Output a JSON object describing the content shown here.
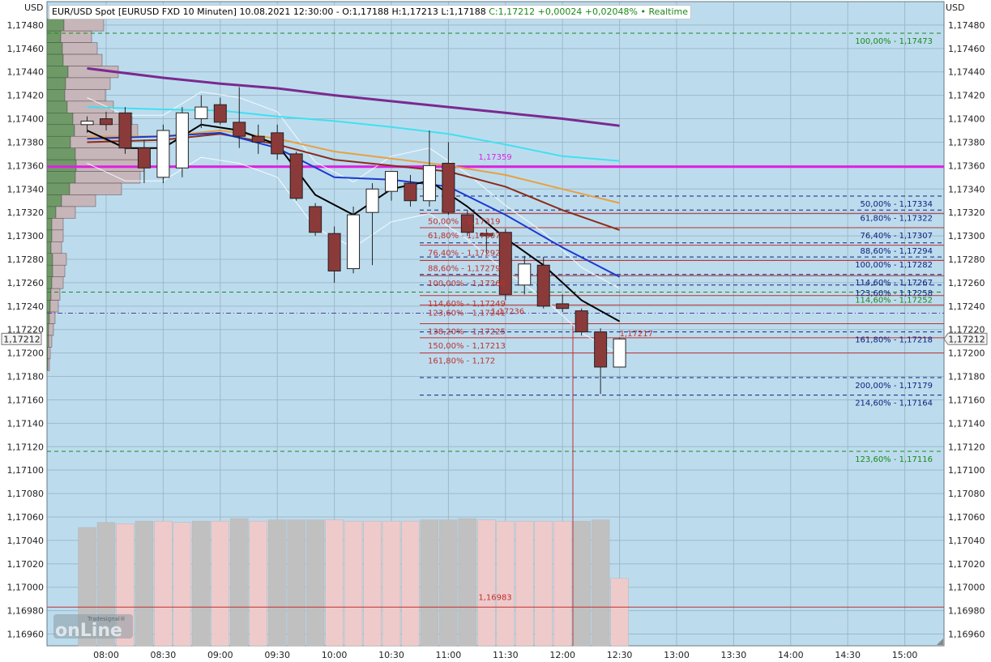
{
  "header": {
    "title": "EUR/USD Spot [EURUSD FXD 10 Minuten] 10.08.2021 12:30:00 - O:1,17188 H:1,17213 L:1,17188",
    "realtime": "C:1,17212 +0,00024 +0,02048% • Realtime"
  },
  "units": {
    "left": "USD",
    "right": "USD"
  },
  "watermark": {
    "small": "Tradesignal®",
    "big": "onLine"
  },
  "colors": {
    "plot_bg": "#bcdcee",
    "grid": "#9fb8c8",
    "bull": "#ffffff",
    "bear": "#8b3a3a",
    "magenta": "#e020e0",
    "purple": "#7a2a90",
    "cyan": "#40e0f0",
    "blue": "#1a3ad0",
    "brown": "#8b2c1a",
    "orange": "#e8a040",
    "black": "#000000",
    "green_dash": "#1a8a1a",
    "navy_dash": "#102080",
    "red_line": "#c03030"
  },
  "chart_data": {
    "type": "candlestick",
    "instrument": "EUR/USD Spot",
    "ylim": [
      1.1695,
      1.175
    ],
    "y_ticks": [
      "1,16960",
      "1,16980",
      "1,17000",
      "1,17020",
      "1,17040",
      "1,17060",
      "1,17080",
      "1,17100",
      "1,17120",
      "1,17140",
      "1,17160",
      "1,17180",
      "1,17200",
      "1,17220",
      "1,17240",
      "1,17260",
      "1,17280",
      "1,17300",
      "1,17320",
      "1,17340",
      "1,17360",
      "1,17380",
      "1,17400",
      "1,17420",
      "1,17440",
      "1,17460",
      "1,17480"
    ],
    "x_ticks": [
      "08:00",
      "08:30",
      "09:00",
      "09:30",
      "10:00",
      "10:30",
      "11:00",
      "11:30",
      "12:00",
      "12:30",
      "13:00",
      "13:30",
      "14:00",
      "14:30",
      "15:00"
    ],
    "last_price_label": "1,17212",
    "last_price": 1.17212,
    "candles": [
      {
        "t": "07:50",
        "o": 1.17395,
        "h": 1.17402,
        "l": 1.17388,
        "c": 1.17398
      },
      {
        "t": "08:00",
        "o": 1.174,
        "h": 1.17406,
        "l": 1.1739,
        "c": 1.17395
      },
      {
        "t": "08:10",
        "o": 1.17405,
        "h": 1.1741,
        "l": 1.1737,
        "c": 1.17375
      },
      {
        "t": "08:20",
        "o": 1.17375,
        "h": 1.17382,
        "l": 1.17345,
        "c": 1.17358
      },
      {
        "t": "08:30",
        "o": 1.1735,
        "h": 1.17395,
        "l": 1.17345,
        "c": 1.1739
      },
      {
        "t": "08:40",
        "o": 1.17358,
        "h": 1.1741,
        "l": 1.1735,
        "c": 1.17405
      },
      {
        "t": "08:50",
        "o": 1.174,
        "h": 1.1742,
        "l": 1.17392,
        "c": 1.1741
      },
      {
        "t": "09:00",
        "o": 1.17412,
        "h": 1.17418,
        "l": 1.17395,
        "c": 1.17397
      },
      {
        "t": "09:10",
        "o": 1.17397,
        "h": 1.17427,
        "l": 1.17375,
        "c": 1.17385
      },
      {
        "t": "09:20",
        "o": 1.17385,
        "h": 1.17395,
        "l": 1.1737,
        "c": 1.1738
      },
      {
        "t": "09:30",
        "o": 1.17388,
        "h": 1.17395,
        "l": 1.17365,
        "c": 1.1737
      },
      {
        "t": "09:40",
        "o": 1.1737,
        "h": 1.17372,
        "l": 1.1733,
        "c": 1.17332
      },
      {
        "t": "09:50",
        "o": 1.17325,
        "h": 1.17328,
        "l": 1.173,
        "c": 1.17303
      },
      {
        "t": "10:00",
        "o": 1.17302,
        "h": 1.17308,
        "l": 1.1726,
        "c": 1.1727
      },
      {
        "t": "10:10",
        "o": 1.17272,
        "h": 1.17325,
        "l": 1.17268,
        "c": 1.17318
      },
      {
        "t": "10:20",
        "o": 1.1732,
        "h": 1.17345,
        "l": 1.17275,
        "c": 1.1734
      },
      {
        "t": "10:30",
        "o": 1.17338,
        "h": 1.17355,
        "l": 1.1733,
        "c": 1.17355
      },
      {
        "t": "10:40",
        "o": 1.17345,
        "h": 1.17352,
        "l": 1.17325,
        "c": 1.1733
      },
      {
        "t": "10:50",
        "o": 1.1733,
        "h": 1.1739,
        "l": 1.17325,
        "c": 1.1736
      },
      {
        "t": "11:00",
        "o": 1.17362,
        "h": 1.1738,
        "l": 1.17318,
        "c": 1.1732
      },
      {
        "t": "11:10",
        "o": 1.17318,
        "h": 1.17322,
        "l": 1.173,
        "c": 1.17303
      },
      {
        "t": "11:20",
        "o": 1.17302,
        "h": 1.17306,
        "l": 1.17285,
        "c": 1.173
      },
      {
        "t": "11:30",
        "o": 1.17303,
        "h": 1.17306,
        "l": 1.17245,
        "c": 1.1725
      },
      {
        "t": "11:40",
        "o": 1.17258,
        "h": 1.17283,
        "l": 1.1725,
        "c": 1.17276
      },
      {
        "t": "11:50",
        "o": 1.17275,
        "h": 1.17282,
        "l": 1.17238,
        "c": 1.1724
      },
      {
        "t": "12:00",
        "o": 1.17242,
        "h": 1.1725,
        "l": 1.17235,
        "c": 1.17238
      },
      {
        "t": "12:10",
        "o": 1.17236,
        "h": 1.17238,
        "l": 1.17215,
        "c": 1.17218
      },
      {
        "t": "12:20",
        "o": 1.17218,
        "h": 1.17221,
        "l": 1.17165,
        "c": 1.17188
      },
      {
        "t": "12:30",
        "o": 1.17188,
        "h": 1.17213,
        "l": 1.17188,
        "c": 1.17212
      }
    ],
    "volume": [
      {
        "t": "07:50",
        "v": 0.93,
        "up": true
      },
      {
        "t": "08:00",
        "v": 0.97,
        "up": true
      },
      {
        "t": "08:10",
        "v": 0.96,
        "up": false
      },
      {
        "t": "08:20",
        "v": 0.98,
        "up": true
      },
      {
        "t": "08:30",
        "v": 0.98,
        "up": false
      },
      {
        "t": "08:40",
        "v": 0.97,
        "up": false
      },
      {
        "t": "08:50",
        "v": 0.98,
        "up": true
      },
      {
        "t": "09:00",
        "v": 0.98,
        "up": false
      },
      {
        "t": "09:10",
        "v": 1.0,
        "up": true
      },
      {
        "t": "09:20",
        "v": 0.98,
        "up": false
      },
      {
        "t": "09:30",
        "v": 0.99,
        "up": true
      },
      {
        "t": "09:40",
        "v": 0.99,
        "up": true
      },
      {
        "t": "09:50",
        "v": 0.99,
        "up": true
      },
      {
        "t": "10:00",
        "v": 0.99,
        "up": false
      },
      {
        "t": "10:10",
        "v": 0.98,
        "up": false
      },
      {
        "t": "10:20",
        "v": 0.98,
        "up": false
      },
      {
        "t": "10:30",
        "v": 0.98,
        "up": false
      },
      {
        "t": "10:40",
        "v": 0.98,
        "up": false
      },
      {
        "t": "10:50",
        "v": 0.99,
        "up": true
      },
      {
        "t": "11:00",
        "v": 0.99,
        "up": true
      },
      {
        "t": "11:10",
        "v": 1.0,
        "up": true
      },
      {
        "t": "11:20",
        "v": 0.99,
        "up": false
      },
      {
        "t": "11:30",
        "v": 0.98,
        "up": false
      },
      {
        "t": "11:40",
        "v": 0.98,
        "up": false
      },
      {
        "t": "11:50",
        "v": 0.98,
        "up": false
      },
      {
        "t": "12:00",
        "v": 0.98,
        "up": false
      },
      {
        "t": "12:10",
        "v": 0.98,
        "up": true
      },
      {
        "t": "12:20",
        "v": 0.99,
        "up": true
      },
      {
        "t": "12:30",
        "v": 0.53,
        "up": false
      }
    ],
    "moving_averages": [
      {
        "color": "purple",
        "width": 3,
        "points": [
          [
            "07:50",
            1.17443
          ],
          [
            "08:30",
            1.17435
          ],
          [
            "09:00",
            1.1743
          ],
          [
            "09:30",
            1.17426
          ],
          [
            "10:00",
            1.1742
          ],
          [
            "10:30",
            1.17415
          ],
          [
            "11:00",
            1.1741
          ],
          [
            "11:30",
            1.17405
          ],
          [
            "12:00",
            1.174
          ],
          [
            "12:30",
            1.17394
          ]
        ]
      },
      {
        "color": "cyan",
        "width": 2,
        "points": [
          [
            "07:50",
            1.1741
          ],
          [
            "08:30",
            1.17408
          ],
          [
            "09:00",
            1.17407
          ],
          [
            "09:30",
            1.17402
          ],
          [
            "10:00",
            1.17398
          ],
          [
            "10:30",
            1.17393
          ],
          [
            "11:00",
            1.17387
          ],
          [
            "11:30",
            1.17378
          ],
          [
            "12:00",
            1.17368
          ],
          [
            "12:30",
            1.17364
          ]
        ]
      },
      {
        "color": "orange",
        "width": 2,
        "points": [
          [
            "07:50",
            1.17385
          ],
          [
            "08:30",
            1.17385
          ],
          [
            "09:00",
            1.1739
          ],
          [
            "09:30",
            1.17383
          ],
          [
            "10:00",
            1.17372
          ],
          [
            "10:30",
            1.17366
          ],
          [
            "11:00",
            1.1736
          ],
          [
            "11:30",
            1.17352
          ],
          [
            "12:00",
            1.1734
          ],
          [
            "12:30",
            1.17328
          ]
        ]
      },
      {
        "color": "brown",
        "width": 2,
        "points": [
          [
            "07:50",
            1.1738
          ],
          [
            "08:30",
            1.17382
          ],
          [
            "09:00",
            1.17387
          ],
          [
            "09:30",
            1.17378
          ],
          [
            "10:00",
            1.17365
          ],
          [
            "10:30",
            1.1736
          ],
          [
            "11:00",
            1.17355
          ],
          [
            "11:30",
            1.17342
          ],
          [
            "12:00",
            1.17322
          ],
          [
            "12:30",
            1.17305
          ]
        ]
      },
      {
        "color": "blue",
        "width": 2,
        "points": [
          [
            "07:50",
            1.17383
          ],
          [
            "08:30",
            1.17385
          ],
          [
            "09:00",
            1.17388
          ],
          [
            "09:30",
            1.17375
          ],
          [
            "10:00",
            1.1735
          ],
          [
            "10:30",
            1.17348
          ],
          [
            "11:00",
            1.17342
          ],
          [
            "11:30",
            1.17318
          ],
          [
            "12:00",
            1.1729
          ],
          [
            "12:30",
            1.17265
          ]
        ]
      },
      {
        "color": "black",
        "width": 2,
        "points": [
          [
            "07:50",
            1.1739
          ],
          [
            "08:10",
            1.17375
          ],
          [
            "08:30",
            1.17375
          ],
          [
            "08:50",
            1.17395
          ],
          [
            "09:10",
            1.1739
          ],
          [
            "09:30",
            1.17378
          ],
          [
            "09:50",
            1.17335
          ],
          [
            "10:10",
            1.17318
          ],
          [
            "10:30",
            1.1734
          ],
          [
            "10:50",
            1.17347
          ],
          [
            "11:10",
            1.17325
          ],
          [
            "11:30",
            1.17298
          ],
          [
            "11:50",
            1.17275
          ],
          [
            "12:10",
            1.17245
          ],
          [
            "12:30",
            1.17227
          ]
        ]
      }
    ],
    "horizontal_lines": [
      {
        "value": 1.17473,
        "label": "100,00% - 1,17473",
        "style": "green_dash",
        "from": "07:50"
      },
      {
        "value": 1.17359,
        "label": "1,17359",
        "style": "magenta",
        "from": "07:50"
      },
      {
        "value": 1.17334,
        "label": "50,00% - 1,17334",
        "style": "navy_dash",
        "from": "11:00"
      },
      {
        "value": 1.17322,
        "label": "61,80% - 1,17322",
        "style": "navy_dash",
        "from": "11:00"
      },
      {
        "value": 1.17307,
        "label": "76,40% - 1,17307",
        "style": "navy_dash",
        "from": "11:00"
      },
      {
        "value": 1.17294,
        "label": "88,60% - 1,17294",
        "style": "navy_dash",
        "from": "11:00"
      },
      {
        "value": 1.17282,
        "label": "100,00% - 1,17282",
        "style": "navy_dash",
        "from": "11:00"
      },
      {
        "value": 1.17267,
        "label": "114,60% - 1,17267",
        "style": "navy_dash",
        "from": "11:00"
      },
      {
        "value": 1.17258,
        "label": "123,60% - 1,17258",
        "style": "navy_dash",
        "from": "11:00"
      },
      {
        "value": 1.17252,
        "label": "114,60% - 1,17252",
        "style": "green_dash",
        "from": "07:50"
      },
      {
        "value": 1.17218,
        "label": "161,80% - 1,17218",
        "style": "navy_dash",
        "from": "11:00"
      },
      {
        "value": 1.17179,
        "label": "200,00% - 1,17179",
        "style": "navy_dash",
        "from": "11:00"
      },
      {
        "value": 1.17164,
        "label": "214,60% - 1,17164",
        "style": "navy_dash",
        "from": "11:00"
      },
      {
        "value": 1.17116,
        "label": "123,60% - 1,17116",
        "style": "green_dash",
        "from": "07:50"
      },
      {
        "value": 1.16983,
        "label": "1,16983",
        "style": "red_line",
        "from": "07:50"
      }
    ],
    "red_fib_labels": [
      {
        "value": 1.17319,
        "label": "50,00% - 1,17319"
      },
      {
        "value": 1.17307,
        "label": "61,80% - 1,17307"
      },
      {
        "value": 1.17292,
        "label": "76,40% - 1,17292"
      },
      {
        "value": 1.17279,
        "label": "88,60% - 1,17279"
      },
      {
        "value": 1.17266,
        "label": "100,00% - 1,17266"
      },
      {
        "value": 1.17249,
        "label": "114,60% - 1,17249"
      },
      {
        "value": 1.17241,
        "label": "123,60% - 1,17241"
      },
      {
        "value": 1.17225,
        "label": "138,20% - 1,17225"
      },
      {
        "value": 1.17213,
        "label": "150,00% - 1,17213"
      },
      {
        "value": 1.172,
        "label": "161,80% - 1,172"
      }
    ],
    "extra_labels": [
      {
        "value": 1.17236,
        "label": "1,17236",
        "time": "11:30"
      },
      {
        "value": 1.17217,
        "label": "1,17217",
        "time": "12:30"
      }
    ],
    "volume_profile": [
      {
        "value": 1.1748,
        "w": 70,
        "up": true
      },
      {
        "value": 1.1747,
        "w": 55,
        "up": true
      },
      {
        "value": 1.1746,
        "w": 62,
        "up": true
      },
      {
        "value": 1.1745,
        "w": 68,
        "up": true
      },
      {
        "value": 1.1744,
        "w": 88,
        "up": true
      },
      {
        "value": 1.1743,
        "w": 78,
        "up": true
      },
      {
        "value": 1.1742,
        "w": 72,
        "up": true
      },
      {
        "value": 1.1741,
        "w": 82,
        "up": true
      },
      {
        "value": 1.174,
        "w": 105,
        "up": true
      },
      {
        "value": 1.1739,
        "w": 112,
        "up": true
      },
      {
        "value": 1.1738,
        "w": 95,
        "up": true
      },
      {
        "value": 1.1737,
        "w": 118,
        "up": true
      },
      {
        "value": 1.1736,
        "w": 120,
        "up": true
      },
      {
        "value": 1.1735,
        "w": 115,
        "up": true
      },
      {
        "value": 1.1734,
        "w": 92,
        "up": true
      },
      {
        "value": 1.1733,
        "w": 60,
        "up": true
      },
      {
        "value": 1.1732,
        "w": 35,
        "up": true
      },
      {
        "value": 1.1731,
        "w": 20,
        "up": false
      },
      {
        "value": 1.173,
        "w": 20,
        "up": false
      },
      {
        "value": 1.1729,
        "w": 18,
        "up": false
      },
      {
        "value": 1.1728,
        "w": 24,
        "up": false
      },
      {
        "value": 1.1727,
        "w": 22,
        "up": false
      },
      {
        "value": 1.1726,
        "w": 20,
        "up": false
      },
      {
        "value": 1.1725,
        "w": 16,
        "up": false
      },
      {
        "value": 1.1724,
        "w": 14,
        "up": false
      },
      {
        "value": 1.1723,
        "w": 10,
        "up": false
      },
      {
        "value": 1.1722,
        "w": 8,
        "up": false
      },
      {
        "value": 1.1721,
        "w": 6,
        "up": false
      },
      {
        "value": 1.172,
        "w": 4,
        "up": false
      },
      {
        "value": 1.1719,
        "w": 3,
        "up": false
      }
    ]
  }
}
